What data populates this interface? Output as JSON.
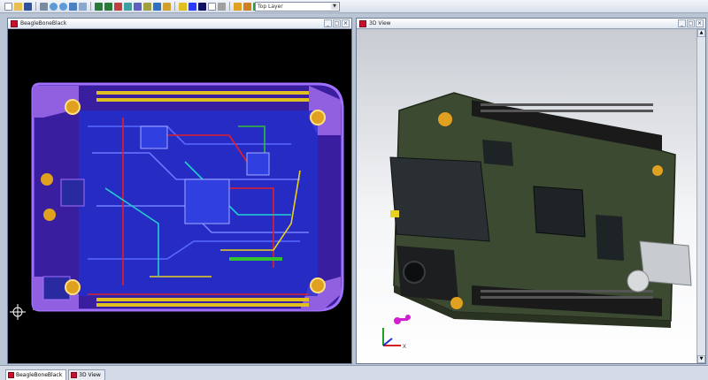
{
  "toolbar": {
    "layer_select_value": "Top Layer",
    "buttons": [
      "new-icon",
      "open-icon",
      "save-icon",
      "print-icon",
      "zoom-in-icon",
      "zoom-out-icon",
      "zoom-fit-icon",
      "zoom-area-icon",
      "undo-icon",
      "redo-icon",
      "cross-probe-icon",
      "wire-icon",
      "bus-icon",
      "component-icon",
      "net-icon",
      "pad-icon",
      "via-icon",
      "track-icon",
      "polygon-icon",
      "text-icon",
      "dimension-icon",
      "rule-icon",
      "measure-icon",
      "grid-icon",
      "layer-icon",
      "3d-icon",
      "select-icon",
      "move-icon",
      "rotate-icon",
      "delete-icon",
      "help-icon"
    ]
  },
  "panels": {
    "pcb": {
      "title": "BeagleBoneBlack"
    },
    "view3d": {
      "title": "3D View"
    }
  },
  "tabs": [
    {
      "label": "BeagleBoneBlack",
      "active": true
    },
    {
      "label": "3D View",
      "active": false
    }
  ],
  "colors": {
    "board_purple": "#8a50d8",
    "trace_blue": "#2a3cff",
    "trace_red": "#e0202a",
    "trace_yellow": "#e8d020",
    "trace_cyan": "#20d0d0",
    "trace_green": "#30c030",
    "pcb_background": "#000000",
    "board_green": "#3d4a32"
  },
  "axis_labels": {
    "x": "X",
    "y": "Y",
    "z": "Z"
  }
}
